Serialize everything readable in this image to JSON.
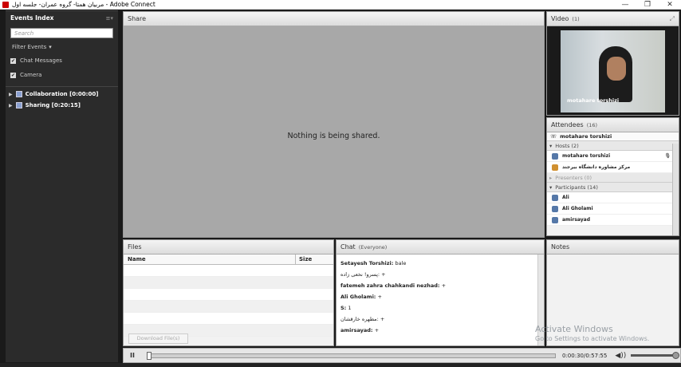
{
  "window": {
    "title": "مربیان همتا- گروه عمران- جلسه اول - Adobe Connect",
    "minimize": "—",
    "restore": "❐",
    "close": "✕"
  },
  "events_index": {
    "title": "Events Index",
    "menu_icon": "≡▾",
    "search_placeholder": "Search",
    "filter_label": "Filter Events",
    "checkboxes": [
      {
        "label": "Chat Messages",
        "checked": true
      },
      {
        "label": "Camera",
        "checked": true
      }
    ],
    "tree": [
      {
        "label": "Collaboration [0:00:00]"
      },
      {
        "label": "Sharing [0:20:15]"
      }
    ]
  },
  "share": {
    "title": "Share",
    "message": "Nothing is being shared."
  },
  "video": {
    "title": "Video",
    "count": "(1)",
    "participant_name": "motahare torshizi"
  },
  "attendees": {
    "title": "Attendees",
    "count": "(16)",
    "me": "motahare torshizi",
    "hosts_label": "Hosts (2)",
    "hosts": [
      "motahare torshizi",
      "مرکز مشاوره دانشگاه بیرجند"
    ],
    "presenters_label": "Presenters (0)",
    "participants_label": "Participants (14)",
    "participants": [
      "Ali",
      "Ali Gholami",
      "amirsayad"
    ]
  },
  "files": {
    "title": "Files",
    "col_name": "Name",
    "col_size": "Size",
    "download_label": "Download File(s)"
  },
  "chat": {
    "title": "Chat",
    "scope": "(Everyone)",
    "messages": [
      {
        "sender": "Setayesh Torshizi:",
        "text": " bale"
      },
      {
        "sender": "",
        "text": "پسرو! نخعی زاده: +"
      },
      {
        "sender": "fatemeh zahra chahkandi nezhad:",
        "text": " +"
      },
      {
        "sender": "Ali Gholami:",
        "text": " +"
      },
      {
        "sender": "S:",
        "text": " 1"
      },
      {
        "sender": "",
        "text": "مطهره خارقشان: +"
      },
      {
        "sender": "amirsayad:",
        "text": " +"
      }
    ]
  },
  "notes": {
    "title": "Notes"
  },
  "watermark": {
    "line1": "Activate Windows",
    "line2": "Go to Settings to activate Windows."
  },
  "player": {
    "pause_label": "II",
    "time": "0:00:30/0:57:55",
    "volume_icon": "◀))"
  }
}
